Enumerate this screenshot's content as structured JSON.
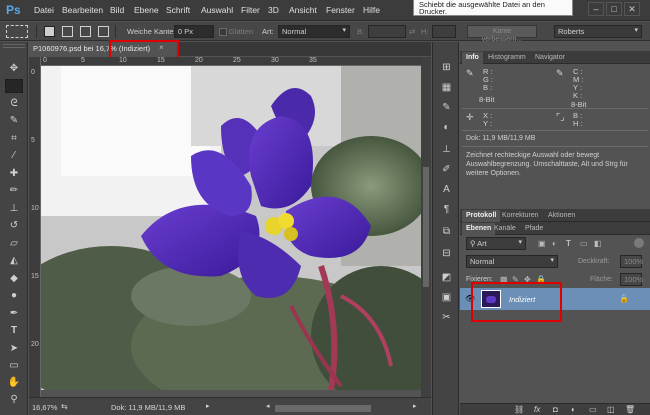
{
  "app": {
    "logo": "Ps"
  },
  "menu": [
    "Datei",
    "Bearbeiten",
    "Bild",
    "Ebene",
    "Schrift",
    "Auswahl",
    "Filter",
    "3D",
    "Ansicht",
    "Fenster",
    "Hilfe"
  ],
  "tooltip": {
    "text": "Schiebt die ausgewählte Datei an den Drucker."
  },
  "window_controls": {
    "minimize": "–",
    "maximize": "□",
    "close": "✕"
  },
  "options": {
    "feather_label": "Weiche Kante:",
    "feather_value": "0 Px",
    "antialias_label": "Glätten",
    "style_label": "Art:",
    "style_value": "Normal",
    "width_label": "B:",
    "height_label": "H:",
    "refine_edge": "Kante verbessern...",
    "workspace": "Roberts"
  },
  "document": {
    "tab_title": "P1060976.psd bei 16,7% (Indiziert)",
    "tab_close": "×",
    "ruler_h": [
      "0",
      "5",
      "10",
      "15",
      "20",
      "25",
      "30",
      "35"
    ],
    "ruler_v": [
      "0",
      "5",
      "10",
      "15",
      "20"
    ],
    "zoom": "16,67%",
    "doc_size": "Dok: 11,9 MB/11,9 MB"
  },
  "info_panel": {
    "tabs": [
      "Info",
      "Histogramm",
      "Navigator"
    ],
    "rgb": [
      "R :",
      "G :",
      "B :"
    ],
    "rgb_bits": "8-Bit",
    "cmyk": [
      "C :",
      "M :",
      "Y :",
      "K :"
    ],
    "cmyk_bits": "8-Bit",
    "xy": [
      "X :",
      "Y :"
    ],
    "wh": [
      "B :",
      "H :"
    ],
    "doc_size": "Dok: 11,9 MB/11,9 MB",
    "hint": "Zeichnet rechteckige Auswahl oder bewegt Auswahlbegrenzung. Umschalttaste, Alt und Strg für weitere Optionen."
  },
  "protocol_panel": {
    "tabs": [
      "Protokoll",
      "Korrekturen",
      "Aktionen"
    ]
  },
  "layers_panel": {
    "tabs": [
      "Ebenen",
      "Kanäle",
      "Pfade"
    ],
    "filter_kind": "Art",
    "blend_mode": "Normal",
    "opacity_label": "Deckkraft:",
    "opacity_value": "100%",
    "lock_label": "Fixieren:",
    "fill_label": "Fläche:",
    "fill_value": "100%",
    "layers": [
      {
        "name": "Indiziert"
      }
    ],
    "bottom_icons": [
      "link",
      "fx",
      "mask",
      "adjust",
      "folder",
      "new",
      "trash"
    ]
  }
}
